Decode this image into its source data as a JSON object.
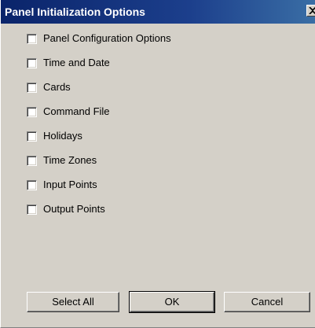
{
  "window": {
    "title": "Panel Initialization Options"
  },
  "options": [
    {
      "label": "Panel Configuration Options",
      "checked": false
    },
    {
      "label": "Time and Date",
      "checked": false
    },
    {
      "label": "Cards",
      "checked": false
    },
    {
      "label": "Command File",
      "checked": false
    },
    {
      "label": "Holidays",
      "checked": false
    },
    {
      "label": "Time Zones",
      "checked": false
    },
    {
      "label": "Input Points",
      "checked": false
    },
    {
      "label": "Output Points",
      "checked": false
    }
  ],
  "buttons": {
    "select_all": "Select All",
    "ok": "OK",
    "cancel": "Cancel"
  },
  "colors": {
    "titlebar": "#0a246a",
    "dialog_background": "#d4d0c8"
  }
}
